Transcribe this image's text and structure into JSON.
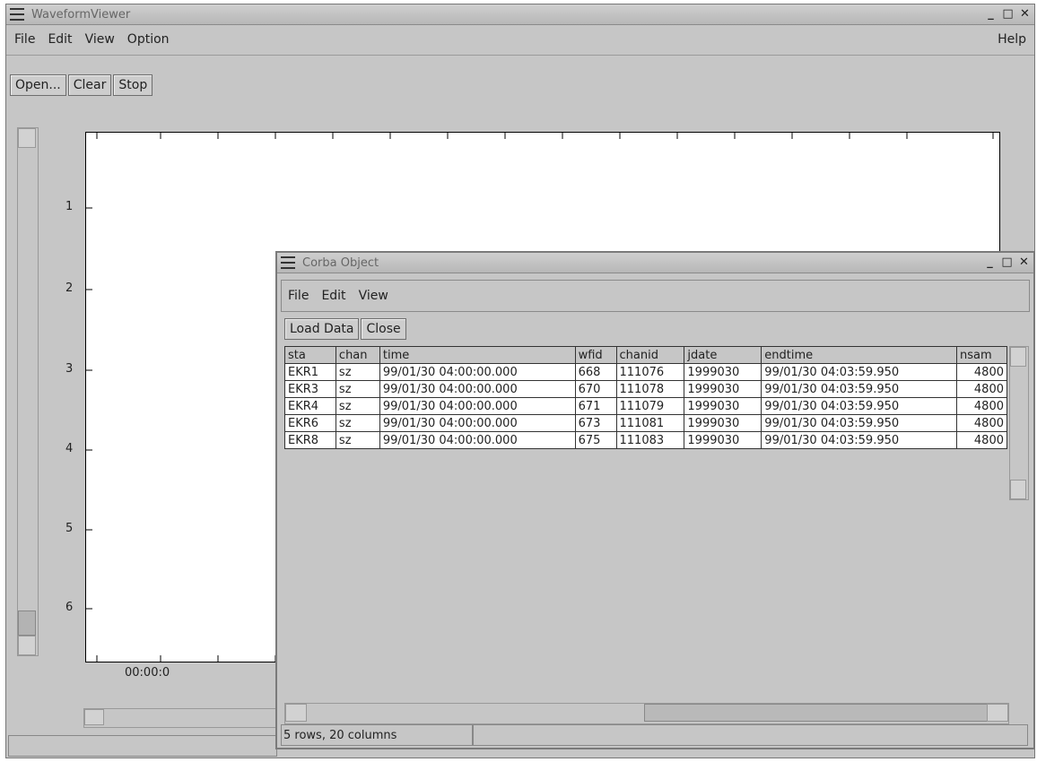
{
  "main_window": {
    "title": "WaveformViewer",
    "menus": [
      "File",
      "Edit",
      "View",
      "Option"
    ],
    "help": "Help",
    "toolbar": [
      "Open...",
      "Clear",
      "Stop"
    ],
    "y_ticks": [
      "1",
      "2",
      "3",
      "4",
      "5",
      "6"
    ],
    "x_label": "00:00:0"
  },
  "corba_window": {
    "title": "Corba Object",
    "menus": [
      "File",
      "Edit",
      "View"
    ],
    "toolbar": [
      "Load Data",
      "Close"
    ],
    "columns": [
      "sta",
      "chan",
      "time",
      "wfid",
      "chanid",
      "jdate",
      "endtime",
      "nsam"
    ],
    "rows": [
      [
        "EKR1",
        "sz",
        "99/01/30 04:00:00.000",
        "668",
        "111076",
        "1999030",
        "99/01/30 04:03:59.950",
        "4800"
      ],
      [
        "EKR3",
        "sz",
        "99/01/30 04:00:00.000",
        "670",
        "111078",
        "1999030",
        "99/01/30 04:03:59.950",
        "4800"
      ],
      [
        "EKR4",
        "sz",
        "99/01/30 04:00:00.000",
        "671",
        "111079",
        "1999030",
        "99/01/30 04:03:59.950",
        "4800"
      ],
      [
        "EKR6",
        "sz",
        "99/01/30 04:00:00.000",
        "673",
        "111081",
        "1999030",
        "99/01/30 04:03:59.950",
        "4800"
      ],
      [
        "EKR8",
        "sz",
        "99/01/30 04:00:00.000",
        "675",
        "111083",
        "1999030",
        "99/01/30 04:03:59.950",
        "4800"
      ]
    ],
    "status": "5 rows, 20 columns"
  },
  "icons": {
    "window_menu": "hamburger-icon",
    "minimize": "minimize-icon",
    "maximize": "maximize-icon",
    "close": "close-icon"
  }
}
